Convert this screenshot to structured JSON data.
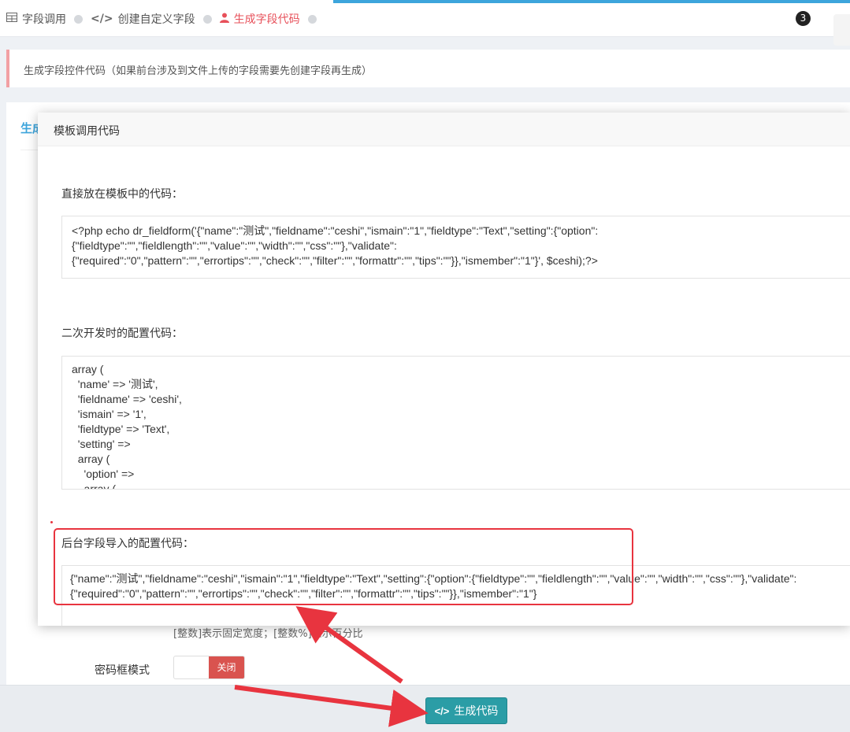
{
  "breadcrumb": {
    "items": [
      {
        "label": "字段调用",
        "icon": "table-icon",
        "active": false
      },
      {
        "label": "创建自定义字段",
        "icon": "code-icon",
        "active": false
      },
      {
        "label": "生成字段代码",
        "icon": "user-icon",
        "active": true
      }
    ]
  },
  "header": {
    "notification_count": "3"
  },
  "note": {
    "text": "生成字段控件代码（如果前台涉及到文件上传的字段需要先创建字段再生成）"
  },
  "card": {
    "title": "生成",
    "help_text": "[整数]表示固定宽度；[整数%]表示百分比",
    "password_mode_label": "密码框模式",
    "toggle_off_label": "关闭"
  },
  "modal": {
    "title": "模板调用代码",
    "section1_label": "直接放在模板中的代码：",
    "section1_lines": [
      "<?php echo dr_fieldform('{\"name\":\"测试\",\"fieldname\":\"ceshi\",\"ismain\":\"1\",\"fieldtype\":\"Text\",\"setting\":{\"option\":",
      "{\"fieldtype\":\"\",\"fieldlength\":\"\",\"value\":\"\",\"width\":\"\",\"css\":\"\"},\"validate\":",
      "{\"required\":\"0\",\"pattern\":\"\",\"errortips\":\"\",\"check\":\"\",\"filter\":\"\",\"formattr\":\"\",\"tips\":\"\"}},\"ismember\":\"1\"}', $ceshi);?>"
    ],
    "section2_label": "二次开发时的配置代码：",
    "section2_lines": [
      "array (",
      "  'name' => '测试',",
      "  'fieldname' => 'ceshi',",
      "  'ismain' => '1',",
      "  'fieldtype' => 'Text',",
      "  'setting' =>",
      "  array (",
      "    'option' =>",
      "    array ("
    ],
    "section3_label": "后台字段导入的配置代码：",
    "section3_lines": [
      "{\"name\":\"测试\",\"fieldname\":\"ceshi\",\"ismain\":\"1\",\"fieldtype\":\"Text\",\"setting\":{\"option\":{\"fieldtype\":\"\",\"fieldlength\":\"\",\"value\":\"\",\"width\":\"\",\"css\":\"\"},\"validate\":",
      "{\"required\":\"0\",\"pattern\":\"\",\"errortips\":\"\",\"check\":\"\",\"filter\":\"\",\"formattr\":\"\",\"tips\":\"\"}},\"ismember\":\"1\"}"
    ]
  },
  "footer": {
    "generate_button_label": "生成代码",
    "generate_button_icon": "code-icon"
  },
  "colors": {
    "accent": "#3da5dc",
    "active": "#e7505a",
    "button": "#2b9da6",
    "annotation": "#e8343f"
  }
}
